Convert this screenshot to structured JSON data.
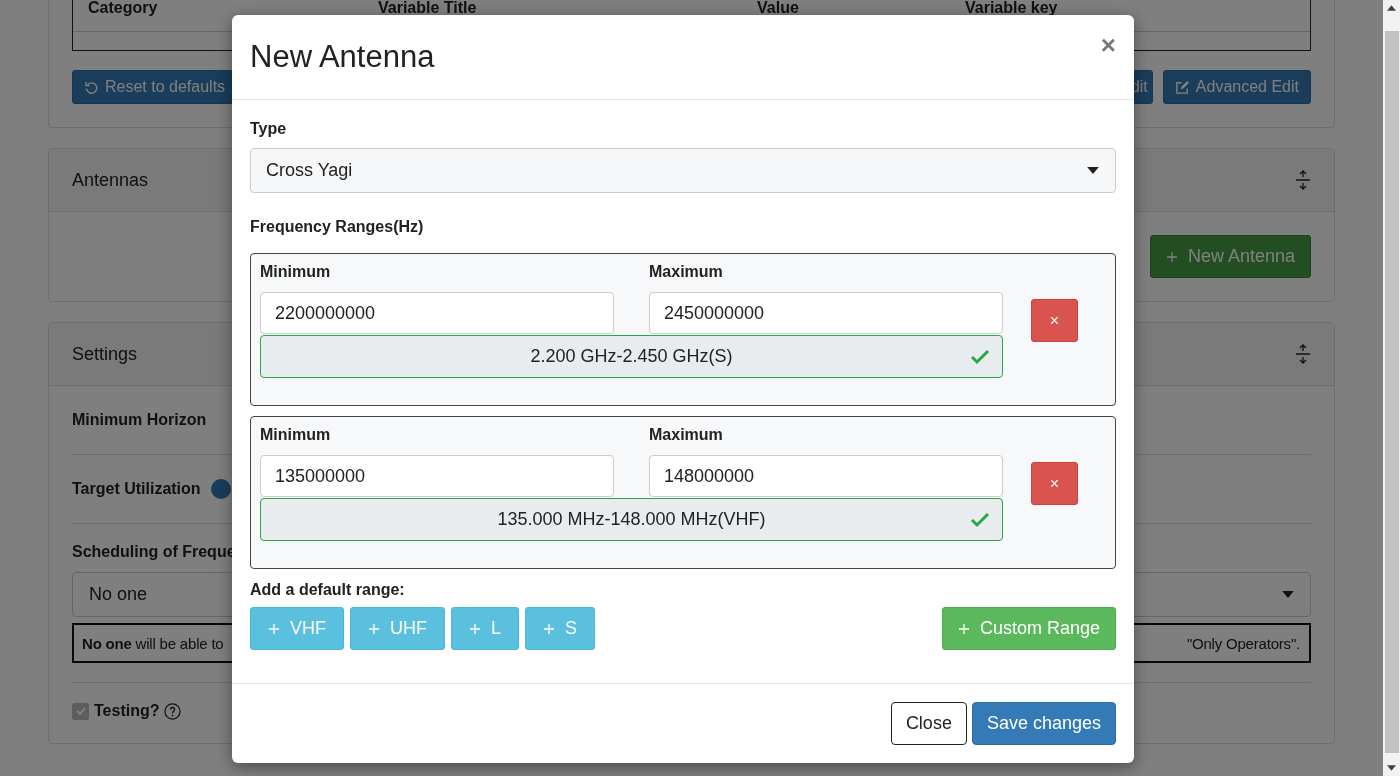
{
  "background": {
    "table": {
      "columns": [
        "Category",
        "Variable Title",
        "Value",
        "Variable key"
      ]
    },
    "actions": [
      {
        "label": "Reset to defaults",
        "kind": "reset"
      },
      {
        "label": "dit",
        "kind": "plain"
      },
      {
        "label": "Advanced Edit",
        "kind": "edit"
      }
    ],
    "antennas_card": {
      "title": "Antennas",
      "button": "New Antenna"
    },
    "settings_card": {
      "title": "Settings",
      "rows": [
        {
          "label": "Minimum Horizon",
          "kind": "plain"
        },
        {
          "label": "Target Utilization",
          "kind": "slider"
        }
      ],
      "scheduling": {
        "label": "Scheduling of Freque",
        "value": "No one",
        "note_left": "**No one** will be able to",
        "note_right": "\"Only Operators\"."
      },
      "testing": {
        "label": "Testing?",
        "checked": true
      }
    }
  },
  "modal": {
    "title": "New Antenna",
    "close": "×",
    "type": {
      "label": "Type",
      "value": "Cross Yagi"
    },
    "ranges_label": "Frequency Ranges(Hz)",
    "ranges": [
      {
        "min_label": "Minimum",
        "min": "2200000000",
        "max_label": "Maximum",
        "max": "2450000000",
        "summary": "2.200 GHz-2.450 GHz(S)",
        "valid": true,
        "remove": "×"
      },
      {
        "min_label": "Minimum",
        "min": "135000000",
        "max_label": "Maximum",
        "max": "148000000",
        "summary": "135.000 MHz-148.000 MHz(VHF)",
        "valid": true,
        "remove": "×"
      }
    ],
    "add_label": "Add a default range:",
    "presets": [
      "VHF",
      "UHF",
      "L",
      "S"
    ],
    "custom": "Custom Range",
    "buttons": [
      {
        "label": "Close",
        "kind": "secondary"
      },
      {
        "label": "Save changes",
        "kind": "primary"
      }
    ]
  }
}
